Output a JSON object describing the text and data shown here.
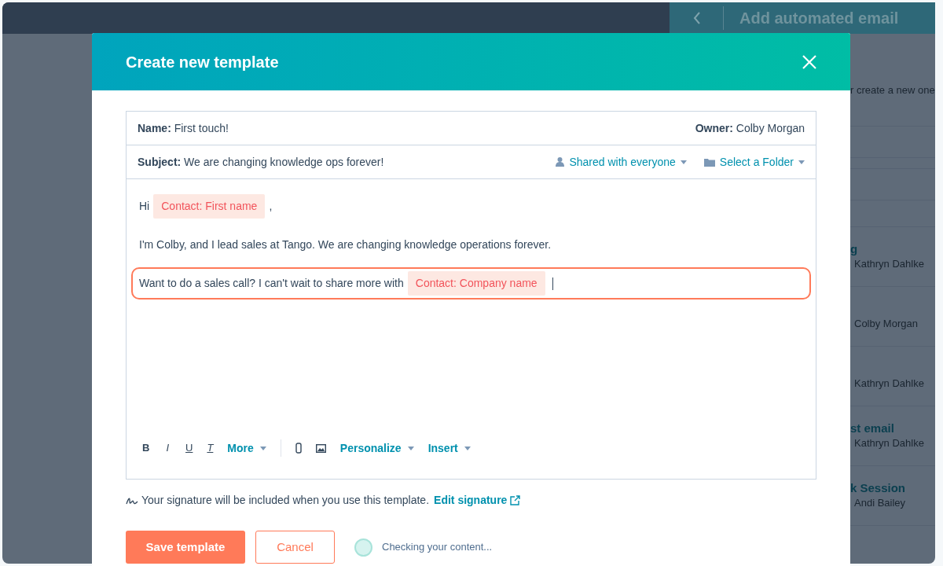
{
  "background_panel": {
    "title": "Add automated email",
    "hint": "r create a new one",
    "items": [
      {
        "name": "g",
        "owner": "Kathryn Dahlke"
      },
      {
        "owner": "Colby Morgan"
      },
      {
        "owner": "Kathryn Dahlke"
      },
      {
        "name": "st email",
        "owner": "Kathryn Dahlke"
      },
      {
        "name": "k Session",
        "owner": "Andi Bailey"
      }
    ]
  },
  "modal": {
    "title": "Create new template",
    "name": {
      "label": "Name:",
      "value": "First touch!"
    },
    "owner": {
      "label": "Owner:",
      "value": "Colby Morgan"
    },
    "subject": {
      "label": "Subject:",
      "value": "We are changing knowledge ops forever!"
    },
    "sharing": "Shared with everyone",
    "folder": "Select a Folder",
    "body": [
      {
        "highlighted": false,
        "segments": [
          {
            "kind": "text",
            "text": "Hi"
          },
          {
            "kind": "token",
            "text": "Contact: First name"
          },
          {
            "kind": "text",
            "text": ","
          }
        ]
      },
      {
        "highlighted": false,
        "segments": [
          {
            "kind": "text",
            "text": "I'm Colby, and I lead sales at Tango. We are changing knowledge operations forever."
          }
        ]
      },
      {
        "highlighted": true,
        "segments": [
          {
            "kind": "text",
            "text": "Want to do a sales call? I can't wait to share more with"
          },
          {
            "kind": "token",
            "text": "Contact: Company name"
          }
        ]
      }
    ],
    "toolbar": [
      {
        "kind": "bold",
        "text": "B"
      },
      {
        "kind": "italic",
        "text": "I"
      },
      {
        "kind": "underline",
        "text": "U"
      },
      {
        "kind": "clear",
        "text": "T"
      },
      {
        "kind": "menu",
        "text": "More"
      },
      {
        "kind": "divider"
      },
      {
        "kind": "link"
      },
      {
        "kind": "image"
      },
      {
        "kind": "menu",
        "text": "Personalize"
      },
      {
        "kind": "menu",
        "text": "Insert"
      }
    ],
    "signature_note": "Your signature will be included when you use this template.",
    "signature_link": "Edit signature",
    "save_button": "Save template",
    "cancel_button": "Cancel",
    "status": "Checking your content..."
  }
}
